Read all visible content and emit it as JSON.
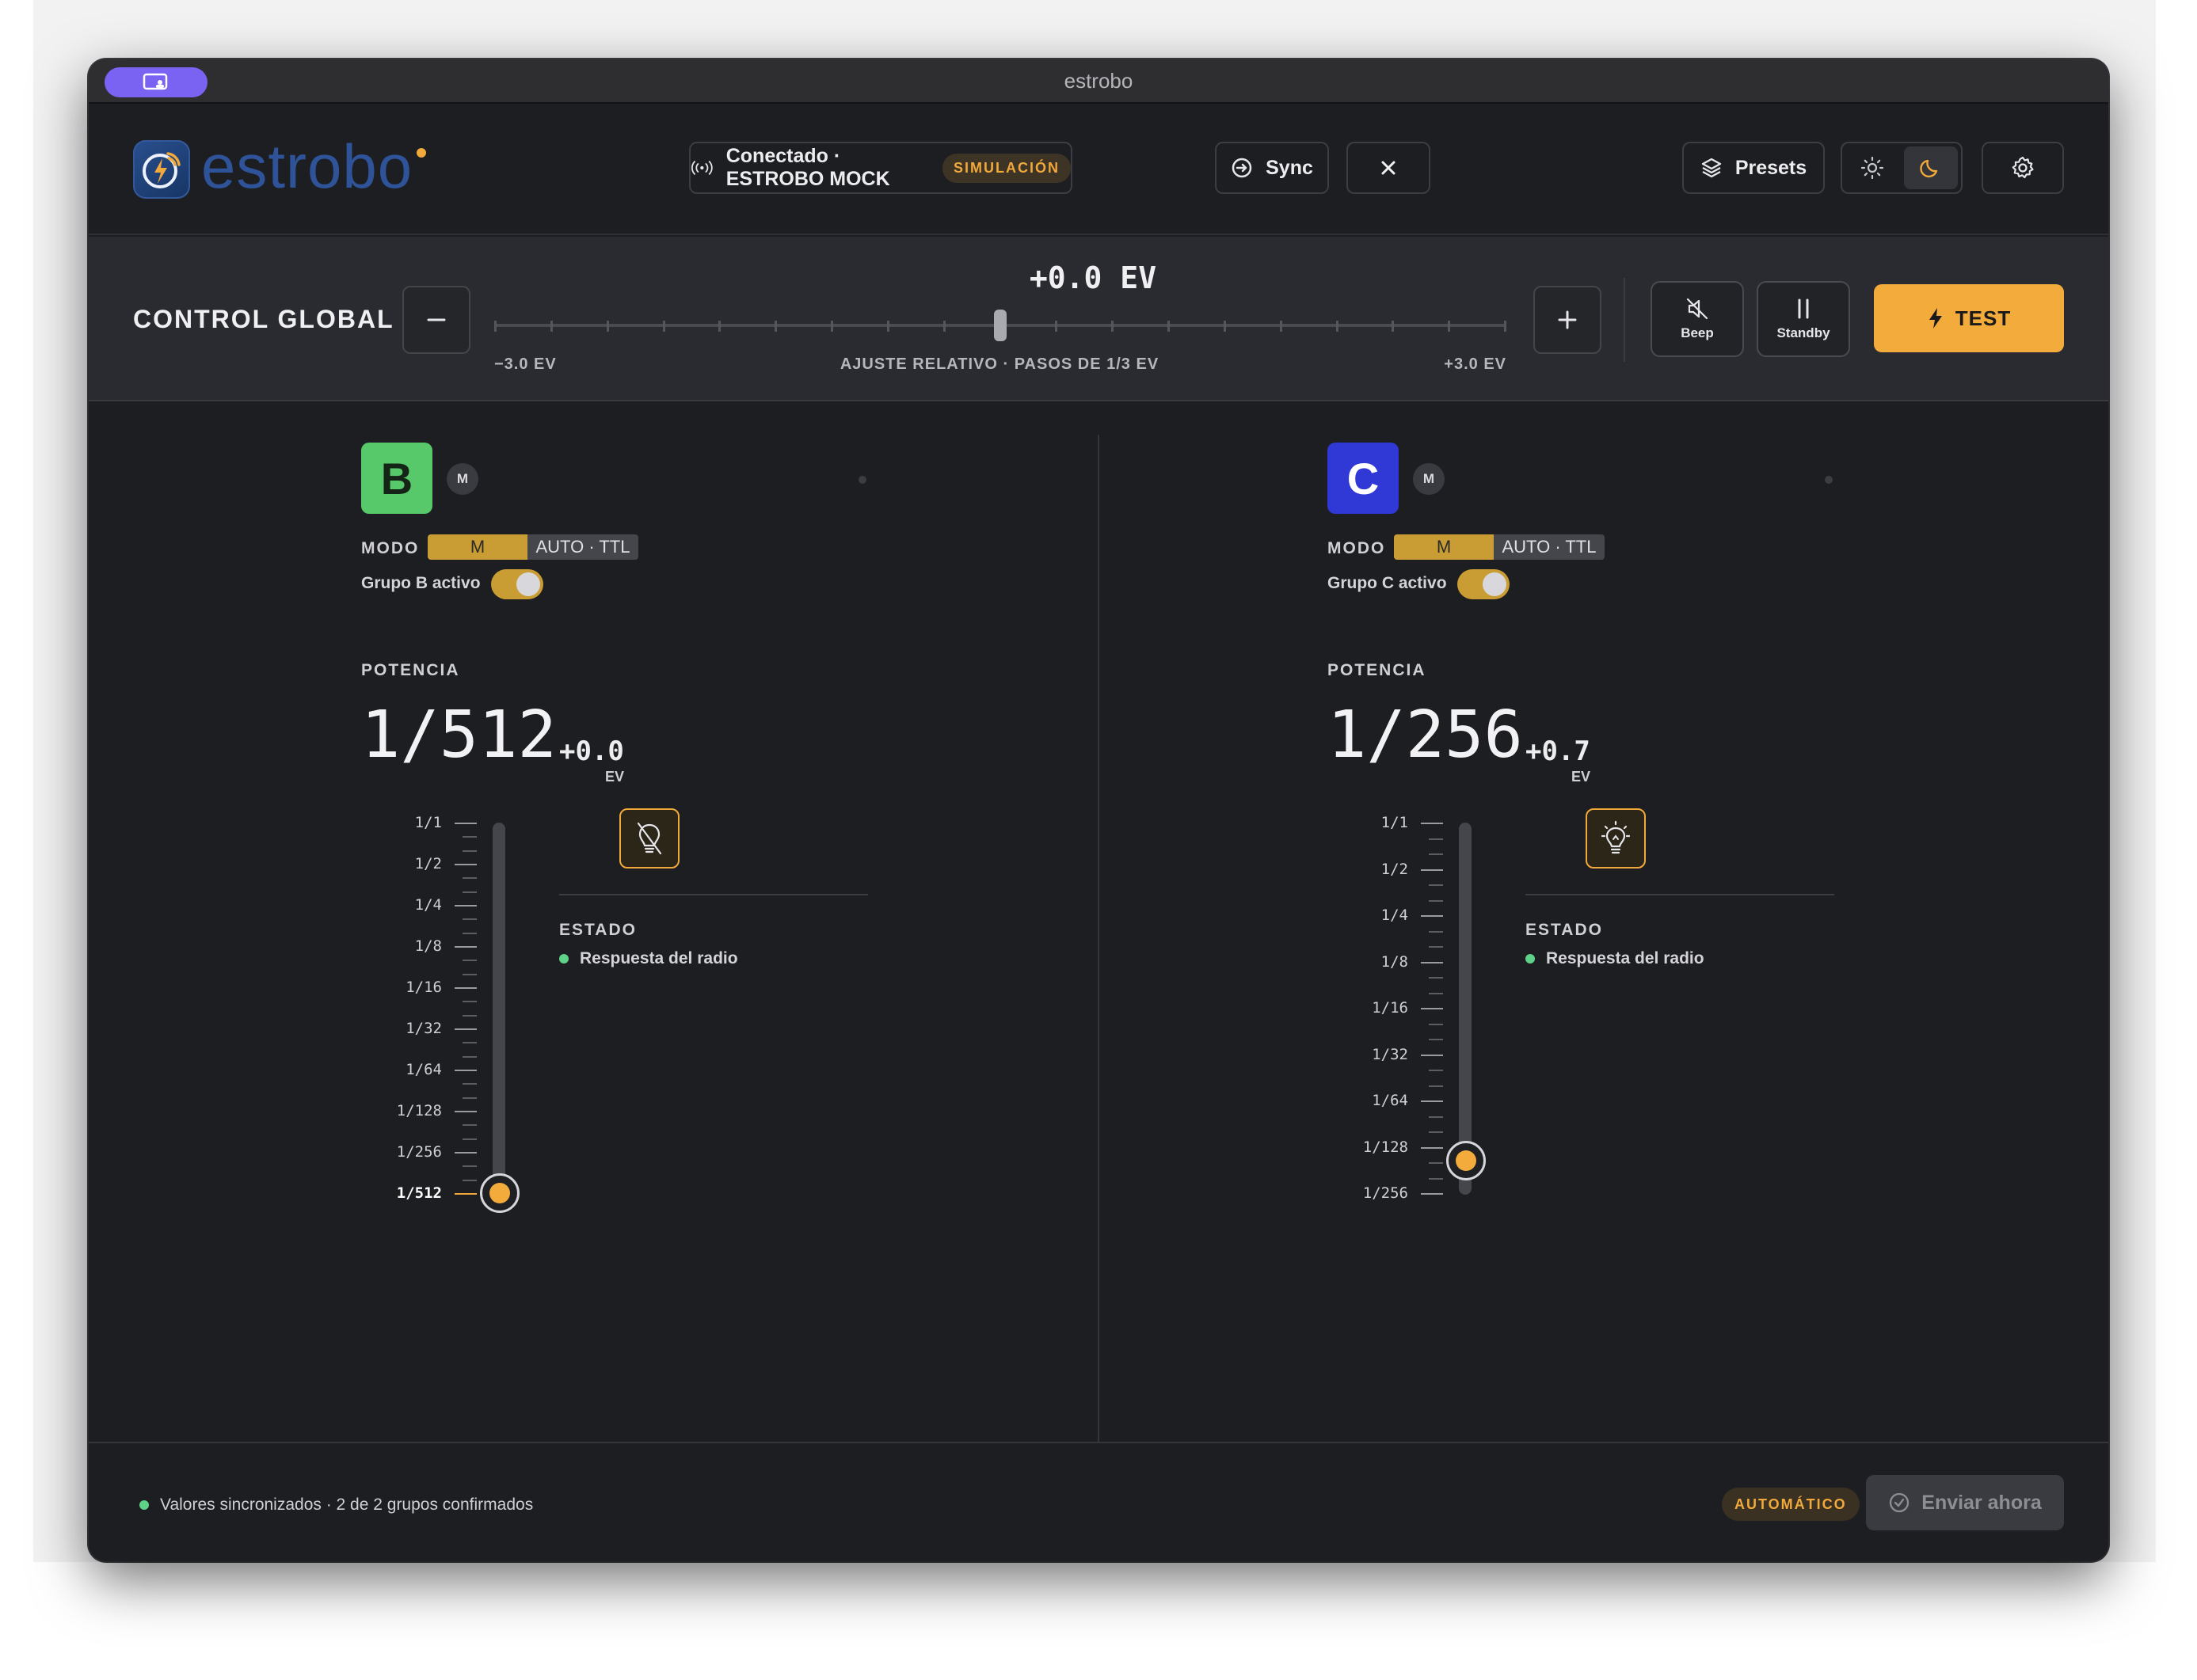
{
  "window": {
    "title": "estrobo"
  },
  "header": {
    "logo_text": "estrobo",
    "connection": {
      "label": "Conectado · ESTROBO MOCK",
      "badge": "SIMULACIÓN"
    },
    "sync_label": "Sync",
    "presets_label": "Presets",
    "theme": {
      "options": [
        "sun-icon",
        "moon-icon"
      ],
      "active": "moon-icon"
    }
  },
  "global_control": {
    "title": "CONTROL GLOBAL",
    "ev_value": "+0.0 EV",
    "slider_value_ev": 0.0,
    "min_label": "−3.0 EV",
    "center_label": "AJUSTE RELATIVO · PASOS DE 1/3 EV",
    "max_label": "+3.0 EV",
    "beep_label": "Beep",
    "standby_label": "Standby",
    "test_label": "TEST"
  },
  "groups": [
    {
      "letter": "B",
      "color": "#58c96a",
      "mode_badge": "M",
      "mode_label": "MODO",
      "mode_options": [
        "M",
        "AUTO · TTL"
      ],
      "mode_selected": "M",
      "active_label": "Grupo B activo",
      "active": true,
      "power_label": "POTENCIA",
      "power_value": "1/512",
      "ev_offset": "+0.0",
      "ev_unit": "EV",
      "scale": [
        "1/1",
        "1/2",
        "1/4",
        "1/8",
        "1/16",
        "1/32",
        "1/64",
        "1/128",
        "1/256",
        "1/512"
      ],
      "scale_selected": "1/512",
      "lamp_state": "lamp-off-icon",
      "status_label": "ESTADO",
      "status_text": "Respuesta del radio"
    },
    {
      "letter": "C",
      "color": "#3038d6",
      "mode_badge": "M",
      "mode_label": "MODO",
      "mode_options": [
        "M",
        "AUTO · TTL"
      ],
      "mode_selected": "M",
      "active_label": "Grupo C activo",
      "active": true,
      "power_label": "POTENCIA",
      "power_value": "1/256",
      "ev_offset": "+0.7",
      "ev_unit": "EV",
      "scale": [
        "1/1",
        "1/2",
        "1/4",
        "1/8",
        "1/16",
        "1/32",
        "1/64",
        "1/128",
        "1/256"
      ],
      "scale_selected": "1/256",
      "slider_value_stops": -7.3,
      "lamp_state": "lamp-on-icon",
      "status_label": "ESTADO",
      "status_text": "Respuesta del radio"
    }
  ],
  "footer": {
    "status_text": "Valores sincronizados · 2 de 2 grupos confirmados",
    "auto_badge": "AUTOMÁTICO",
    "send_label": "Enviar ahora"
  }
}
